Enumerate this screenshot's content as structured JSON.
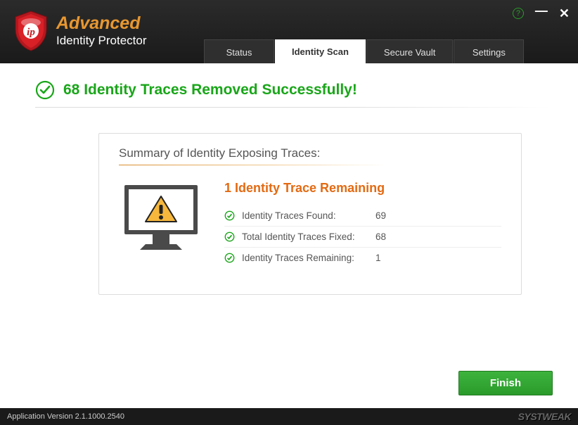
{
  "brand": {
    "title": "Advanced",
    "subtitle": "Identity Protector"
  },
  "window": {
    "help": "?",
    "minimize": "—",
    "close": "✕"
  },
  "tabs": {
    "status": "Status",
    "identity_scan": "Identity Scan",
    "secure_vault": "Secure Vault",
    "settings": "Settings"
  },
  "result": {
    "headline": "68 Identity Traces Removed Successfully!"
  },
  "summary": {
    "title": "Summary of Identity Exposing Traces:",
    "remaining_title": "1 Identity Trace Remaining",
    "rows": [
      {
        "label": "Identity Traces Found:",
        "value": "69"
      },
      {
        "label": "Total Identity Traces Fixed:",
        "value": "68"
      },
      {
        "label": "Identity Traces Remaining:",
        "value": "1"
      }
    ]
  },
  "actions": {
    "finish": "Finish"
  },
  "footer": {
    "version": "Application Version 2.1.1000.2540",
    "brand": "SYSTWEAK"
  }
}
